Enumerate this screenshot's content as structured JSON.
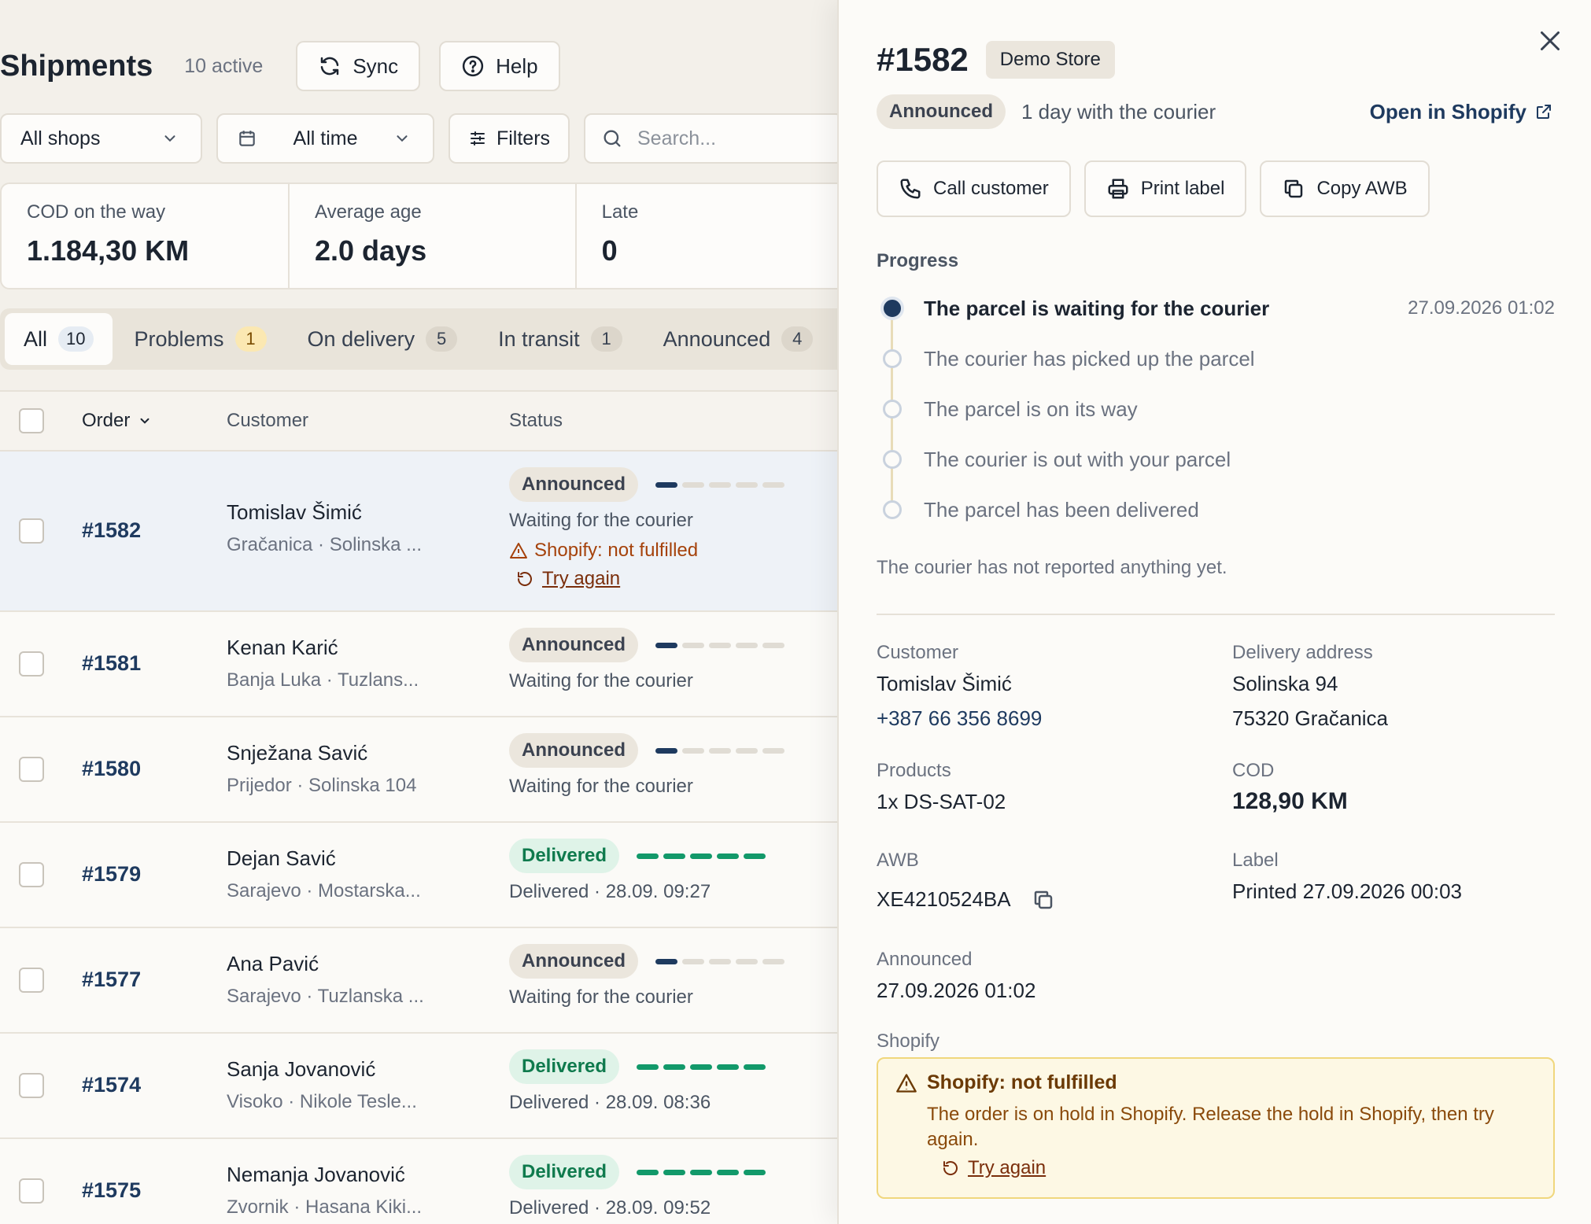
{
  "header": {
    "title": "Shipments",
    "active_count": "10 active",
    "sync_label": "Sync",
    "help_label": "Help"
  },
  "filters": {
    "shops": "All shops",
    "time": "All time",
    "filters_label": "Filters",
    "search_placeholder": "Search..."
  },
  "stats": [
    {
      "label": "COD on the way",
      "value": "1.184,30 KM"
    },
    {
      "label": "Average age",
      "value": "2.0 days"
    },
    {
      "label": "Late",
      "value": "0"
    }
  ],
  "tabs": [
    {
      "label": "All",
      "count": "10"
    },
    {
      "label": "Problems",
      "count": "1"
    },
    {
      "label": "On delivery",
      "count": "5"
    },
    {
      "label": "In transit",
      "count": "1"
    },
    {
      "label": "Announced",
      "count": "4"
    }
  ],
  "table": {
    "headers": {
      "order": "Order",
      "customer": "Customer",
      "status": "Status"
    },
    "rows": [
      {
        "id": "#1582",
        "name": "Tomislav Šimić",
        "addr": "Gračanica · Solinska ...",
        "badge": "Announced",
        "progress": 1,
        "sub": "Waiting for the courier",
        "warning": "Shopify: not fulfilled",
        "retry": "Try again"
      },
      {
        "id": "#1581",
        "name": "Kenan Karić",
        "addr": "Banja Luka · Tuzlans...",
        "badge": "Announced",
        "progress": 1,
        "sub": "Waiting for the courier"
      },
      {
        "id": "#1580",
        "name": "Snježana Savić",
        "addr": "Prijedor · Solinska 104",
        "badge": "Announced",
        "progress": 1,
        "sub": "Waiting for the courier"
      },
      {
        "id": "#1579",
        "name": "Dejan Savić",
        "addr": "Sarajevo · Mostarska...",
        "badge": "Delivered",
        "progress": 5,
        "sub": "Delivered · 28.09. 09:27"
      },
      {
        "id": "#1577",
        "name": "Ana Pavić",
        "addr": "Sarajevo · Tuzlanska ...",
        "badge": "Announced",
        "progress": 1,
        "sub": "Waiting for the courier"
      },
      {
        "id": "#1574",
        "name": "Sanja Jovanović",
        "addr": "Visoko · Nikole Tesle...",
        "badge": "Delivered",
        "progress": 5,
        "sub": "Delivered · 28.09. 08:36"
      },
      {
        "id": "#1575",
        "name": "Nemanja Jovanović",
        "addr": "Zvornik · Hasana Kiki...",
        "badge": "Delivered",
        "progress": 5,
        "sub": "Delivered · 28.09. 09:52"
      }
    ]
  },
  "panel": {
    "order_id": "#1582",
    "store": "Demo Store",
    "status_badge": "Announced",
    "courier_age": "1 day with the courier",
    "open_shopify": "Open in Shopify",
    "actions": {
      "call": "Call customer",
      "print": "Print label",
      "copy": "Copy AWB"
    },
    "progress_title": "Progress",
    "steps": [
      "The parcel is waiting for the courier",
      "The courier has picked up the parcel",
      "The parcel is on its way",
      "The courier is out with your parcel",
      "The parcel has been delivered"
    ],
    "current_step_time": "27.09.2026 01:02",
    "note": "The courier has not reported anything yet.",
    "customer_label": "Customer",
    "customer_name": "Tomislav Šimić",
    "customer_phone": "+387 66 356 8699",
    "address_label": "Delivery address",
    "address_line1": "Solinska 94",
    "address_line2": "75320 Gračanica",
    "products_label": "Products",
    "products_value": "1x DS-SAT-02",
    "cod_label": "COD",
    "cod_value": "128,90 KM",
    "awb_label": "AWB",
    "awb_value": "XE4210524BA",
    "label_label": "Label",
    "label_value": "Printed 27.09.2026 00:03",
    "announced_label": "Announced",
    "announced_value": "27.09.2026 01:02",
    "shopify_label": "Shopify",
    "alert_title": "Shopify: not fulfilled",
    "alert_text": "The order is on hold in Shopify. Release the hold in Shopify, then try again.",
    "alert_retry": "Try again"
  },
  "colors": {
    "accent": "#1e3a5f",
    "delivered": "#12996a",
    "warning": "#a5420b",
    "background": "#f3f0ea"
  }
}
